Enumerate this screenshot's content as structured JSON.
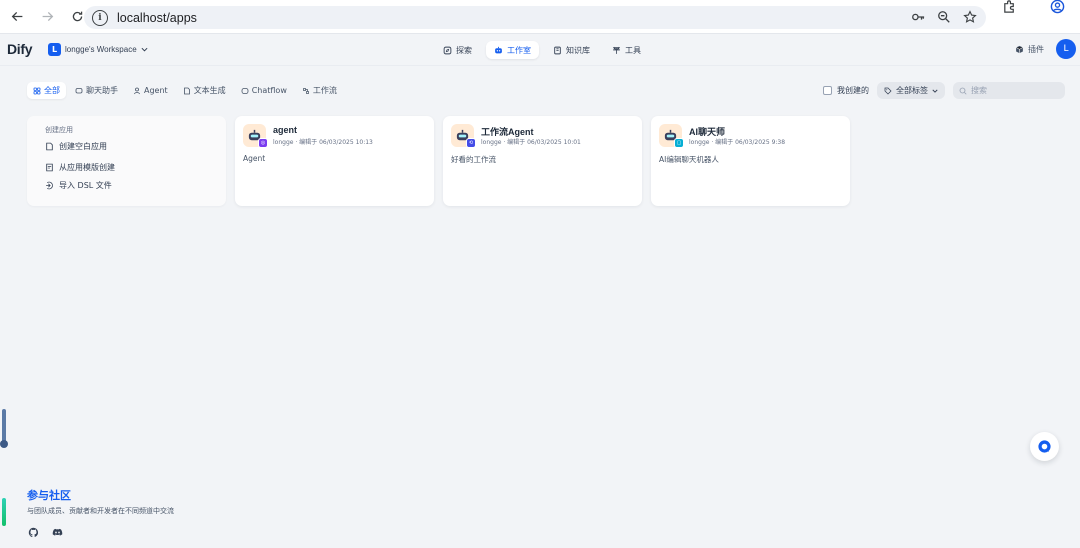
{
  "browser": {
    "url": "localhost/apps"
  },
  "header": {
    "logo": "Dify",
    "workspace": {
      "initial": "L",
      "name": "longge's Workspace"
    },
    "nav": [
      {
        "label": "探索",
        "icon": "compass-icon"
      },
      {
        "label": "工作室",
        "icon": "robot-icon",
        "active": true
      },
      {
        "label": "知识库",
        "icon": "book-icon"
      },
      {
        "label": "工具",
        "icon": "tool-icon"
      }
    ],
    "plugins_label": "插件",
    "user_initial": "L"
  },
  "filters": {
    "tabs": [
      {
        "label": "全部",
        "icon": "grid-icon",
        "active": true
      },
      {
        "label": "聊天助手",
        "icon": "chat-icon"
      },
      {
        "label": "Agent",
        "icon": "agent-icon"
      },
      {
        "label": "文本生成",
        "icon": "doc-icon"
      },
      {
        "label": "Chatflow",
        "icon": "chatflow-icon"
      },
      {
        "label": "工作流",
        "icon": "workflow-icon"
      }
    ],
    "mine_label": "我创建的",
    "tags_label": "全部标签",
    "search_placeholder": "搜索"
  },
  "create_card": {
    "title": "创建应用",
    "items": [
      {
        "label": "创建空白应用",
        "icon": "file-plus-icon"
      },
      {
        "label": "从应用模版创建",
        "icon": "template-icon"
      },
      {
        "label": "导入 DSL 文件",
        "icon": "import-icon"
      }
    ]
  },
  "apps": [
    {
      "name": "agent",
      "meta": "longge · 编辑于 06/03/2025 10:13",
      "desc": "Agent",
      "badge_color": "#7a3cf0",
      "badge_icon": "agent-badge-icon"
    },
    {
      "name": "工作流Agent",
      "meta": "longge · 编辑于 06/03/2025 10:01",
      "desc": "好看的工作流",
      "badge_color": "#444ce7",
      "badge_icon": "workflow-badge-icon"
    },
    {
      "name": "AI聊天师",
      "meta": "longge · 编辑于 06/03/2025 9:38",
      "desc": "AI编辑聊天机器人",
      "badge_color": "#06aed4",
      "badge_icon": "chat-badge-icon"
    }
  ],
  "community": {
    "title": "参与社区",
    "subtitle": "与团队成员、贡献者和开发者在不同频道中交流"
  },
  "colors": {
    "accent": "#155eef",
    "background": "#f2f4f7"
  }
}
